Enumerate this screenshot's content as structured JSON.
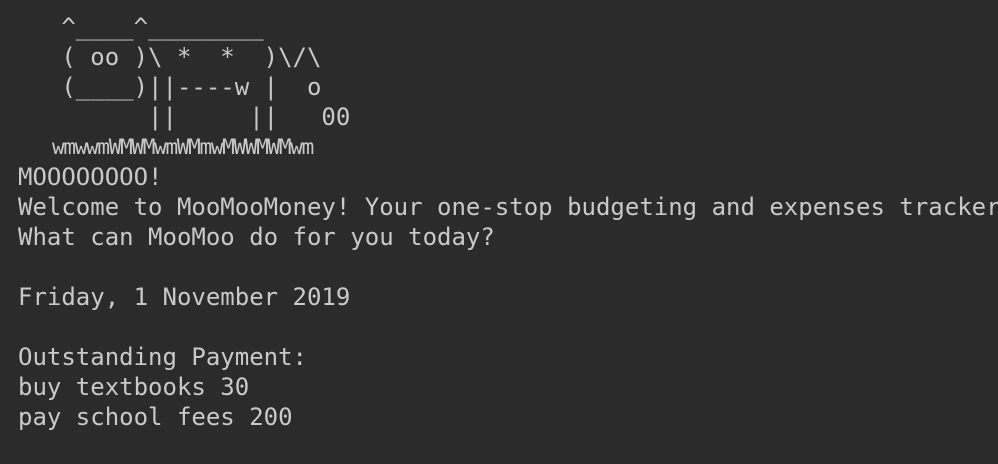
{
  "ascii_cow": [
    "   ^____^________",
    "   ( oo )\\ *  *  )\\/\\",
    "   (____)||----w |  o",
    "         ||     ||   00",
    "   wmwwmWMWMwmWMmwMWWMWMwm"
  ],
  "greeting": "MOOOOOOOO!",
  "welcome": "Welcome to MooMooMoney! Your one-stop budgeting and expenses tracker!",
  "prompt": "What can MooMoo do for you today?",
  "date": "Friday, 1 November 2019",
  "outstanding_header": "Outstanding Payment:",
  "payments": [
    "buy textbooks 30",
    "pay school fees 200"
  ],
  "colors": {
    "background": "#2b2b2b",
    "text": "#c9c9c9"
  }
}
